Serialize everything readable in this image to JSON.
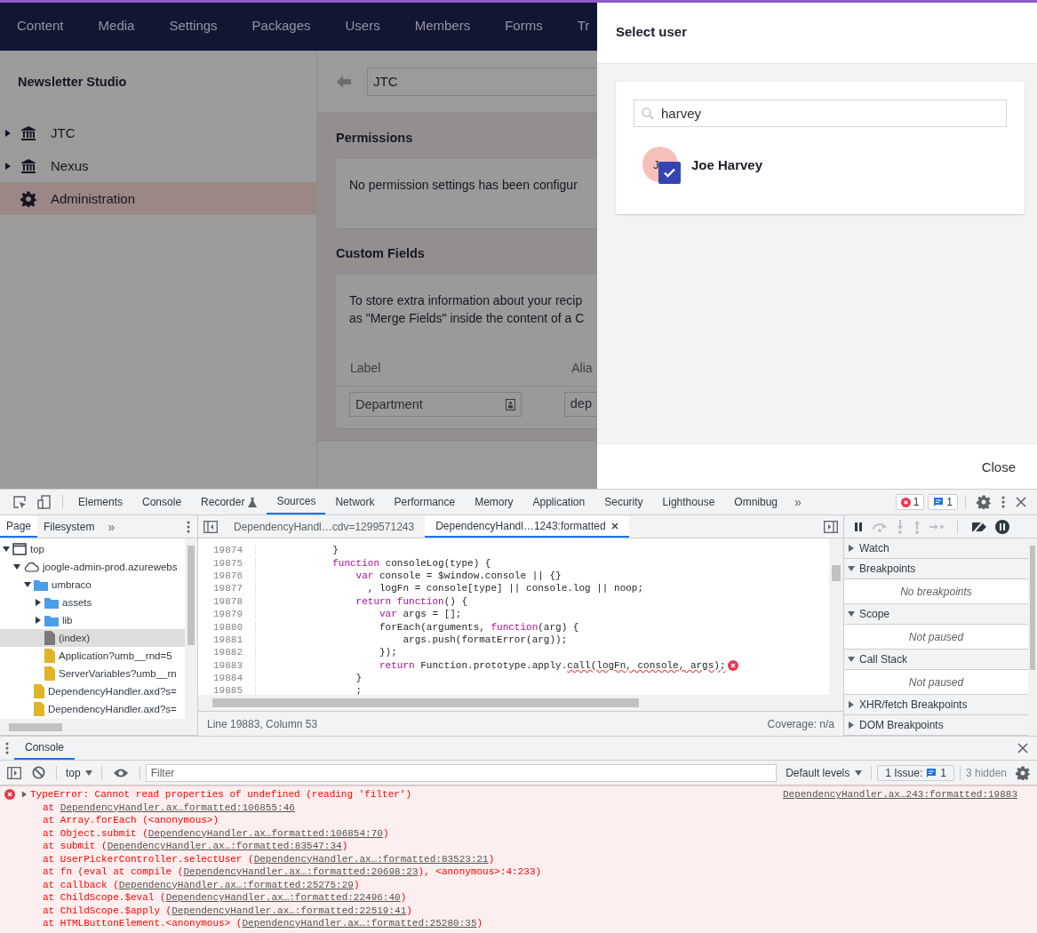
{
  "app": {
    "nav": [
      "Content",
      "Media",
      "Settings",
      "Packages",
      "Users",
      "Members",
      "Forms",
      "Tr"
    ],
    "sidebar": {
      "title": "Newsletter Studio",
      "items": [
        {
          "label": "JTC",
          "kind": "bank",
          "expanded": false,
          "selected": false
        },
        {
          "label": "Nexus",
          "kind": "bank",
          "expanded": false,
          "selected": false
        },
        {
          "label": "Administration",
          "kind": "gear",
          "selected": true
        }
      ]
    },
    "editor": {
      "name": "JTC",
      "permissions": {
        "title": "Permissions",
        "message": "No permission settings has been configur"
      },
      "custom_fields": {
        "title": "Custom Fields",
        "description": [
          "To store extra information about your recip",
          "as \"Merge Fields\" inside the content of a C"
        ],
        "columns": [
          "Label",
          "Alia"
        ],
        "rows": [
          {
            "label": "Department",
            "alias": "dep"
          }
        ]
      }
    }
  },
  "dialog": {
    "title": "Select user",
    "search": {
      "value": "harvey"
    },
    "users": [
      {
        "initials": "J",
        "name": "Joe Harvey",
        "checked": true
      }
    ],
    "close": "Close"
  },
  "devtools": {
    "tabs": [
      {
        "label": "Elements",
        "selected": false,
        "experimental": false
      },
      {
        "label": "Console",
        "selected": false,
        "experimental": false
      },
      {
        "label": "Recorder",
        "selected": false,
        "experimental": true
      },
      {
        "label": "Sources",
        "selected": true,
        "experimental": false
      },
      {
        "label": "Network",
        "selected": false,
        "experimental": false
      },
      {
        "label": "Performance",
        "selected": false,
        "experimental": false
      },
      {
        "label": "Memory",
        "selected": false,
        "experimental": false
      },
      {
        "label": "Application",
        "selected": false,
        "experimental": false
      },
      {
        "label": "Security",
        "selected": false,
        "experimental": false
      },
      {
        "label": "Lighthouse",
        "selected": false,
        "experimental": false
      },
      {
        "label": "Omnibug",
        "selected": false,
        "experimental": false
      }
    ],
    "more": "»",
    "error_count": "1",
    "message_count": "1",
    "navigator": {
      "tabs": [
        {
          "label": "Page",
          "selected": true
        },
        {
          "label": "Filesystem",
          "selected": false
        }
      ],
      "more": "»",
      "tree": [
        {
          "label": "top",
          "kind": "frame",
          "expanded": true,
          "selected": false,
          "children": [
            {
              "label": "joogle-admin-prod.azurewebs",
              "kind": "domain",
              "expanded": true,
              "selected": false,
              "children": [
                {
                  "label": "umbraco",
                  "kind": "folder",
                  "expanded": true,
                  "selected": false,
                  "children": [
                    {
                      "label": "assets",
                      "kind": "folder",
                      "expanded": false,
                      "selected": false
                    },
                    {
                      "label": "lib",
                      "kind": "folder",
                      "expanded": false,
                      "selected": false
                    },
                    {
                      "label": "(index)",
                      "kind": "document",
                      "selected": true
                    },
                    {
                      "label": "Application?umb__rnd=5",
                      "kind": "script",
                      "selected": false
                    },
                    {
                      "label": "ServerVariables?umb__rn",
                      "kind": "script",
                      "selected": false
                    }
                  ]
                },
                {
                  "label": "DependencyHandler.axd?s=",
                  "kind": "script",
                  "selected": false
                },
                {
                  "label": "DependencyHandler.axd?s=",
                  "kind": "script",
                  "selected": false
                }
              ]
            }
          ]
        }
      ]
    },
    "editor_tabs": [
      {
        "label": "DependencyHandl…cdv=1299571243",
        "selected": false,
        "closable": false
      },
      {
        "label": "DependencyHandl…1243:formatted",
        "selected": true,
        "closable": true
      }
    ],
    "code": [
      {
        "num": "19874",
        "segments": [
          {
            "kind": "plain",
            "text": "            }"
          }
        ]
      },
      {
        "num": "19875",
        "segments": [
          {
            "kind": "kw",
            "text": "            function"
          },
          {
            "kind": "plain",
            "text": " consoleLog(type) {"
          }
        ]
      },
      {
        "num": "19876",
        "segments": [
          {
            "kind": "kw",
            "text": "                var"
          },
          {
            "kind": "plain",
            "text": " console = $window.console || {}"
          }
        ]
      },
      {
        "num": "19877",
        "segments": [
          {
            "kind": "plain",
            "text": "                  , logFn = console[type] || console.log || noop;"
          }
        ]
      },
      {
        "num": "19878",
        "segments": [
          {
            "kind": "kw",
            "text": "                return function"
          },
          {
            "kind": "plain",
            "text": "() {"
          }
        ]
      },
      {
        "num": "19879",
        "segments": [
          {
            "kind": "kw",
            "text": "                    var"
          },
          {
            "kind": "plain",
            "text": " args = [];"
          }
        ]
      },
      {
        "num": "19880",
        "segments": [
          {
            "kind": "plain",
            "text": "                    forEach(arguments, "
          },
          {
            "kind": "kw",
            "text": "function"
          },
          {
            "kind": "plain",
            "text": "(arg) {"
          }
        ]
      },
      {
        "num": "19881",
        "segments": [
          {
            "kind": "plain",
            "text": "                        args.push(formatError(arg));"
          }
        ]
      },
      {
        "num": "19882",
        "segments": [
          {
            "kind": "plain",
            "text": "                    });"
          }
        ]
      },
      {
        "num": "19883",
        "error": true,
        "segments": [
          {
            "kind": "kw",
            "text": "                    return"
          },
          {
            "kind": "plain",
            "text": " Function.prototype.apply."
          },
          {
            "kind": "err",
            "text": "call(logFn, console, args);"
          }
        ]
      },
      {
        "num": "19884",
        "segments": [
          {
            "kind": "plain",
            "text": "                }"
          }
        ]
      },
      {
        "num": "19885",
        "segments": [
          {
            "kind": "plain",
            "text": "                ;"
          }
        ]
      }
    ],
    "status": {
      "position": "Line 19883, Column 53",
      "coverage": "Coverage: n/a"
    },
    "debugger": [
      {
        "title": "Watch",
        "expanded": false
      },
      {
        "title": "Breakpoints",
        "expanded": true,
        "message": "No breakpoints"
      },
      {
        "title": "Scope",
        "expanded": true,
        "message": "Not paused"
      },
      {
        "title": "Call Stack",
        "expanded": true,
        "message": "Not paused"
      },
      {
        "title": "XHR/fetch Breakpoints",
        "expanded": false
      },
      {
        "title": "DOM Breakpoints",
        "expanded": false
      }
    ]
  },
  "console": {
    "tab": {
      "label": "Console",
      "selected": true
    },
    "context": "top",
    "filter": {
      "placeholder": "Filter"
    },
    "levels": "Default levels",
    "issues": {
      "label": "1 Issue:",
      "count": "1"
    },
    "hidden": "3 hidden",
    "messages": [
      {
        "kind": "error",
        "expanded": false,
        "text": "TypeError: Cannot read properties of undefined (reading 'filter')",
        "source": "DependencyHandler.ax…243:formatted:19883",
        "stack": [
          {
            "text": "at ",
            "link": "DependencyHandler.ax…formatted:106855:46"
          },
          {
            "text": "at Array.forEach (<anonymous>)"
          },
          {
            "text": "at Object.submit (",
            "link": "DependencyHandler.ax…formatted:106854:70",
            "suffix": ")"
          },
          {
            "text": "at submit (",
            "link": "DependencyHandler.ax…:formatted:83547:34",
            "suffix": ")"
          },
          {
            "text": "at UserPickerController.selectUser (",
            "link": "DependencyHandler.ax…:formatted:83523:21",
            "suffix": ")"
          },
          {
            "text": "at fn (eval at compile (",
            "link": "DependencyHandler.ax…:formatted:20698:23",
            "suffix": "), <anonymous>:4:233)"
          },
          {
            "text": "at callback (",
            "link": "DependencyHandler.ax…:formatted:25275:29",
            "suffix": ")"
          },
          {
            "text": "at ChildScope.$eval (",
            "link": "DependencyHandler.ax…:formatted:22496:40",
            "suffix": ")"
          },
          {
            "text": "at ChildScope.$apply (",
            "link": "DependencyHandler.ax…:formatted:22519:41",
            "suffix": ")"
          },
          {
            "text": "at HTMLButtonElement.<anonymous> (",
            "link": "DependencyHandler.ax…:formatted:25280:35",
            "suffix": ")"
          }
        ]
      }
    ]
  }
}
